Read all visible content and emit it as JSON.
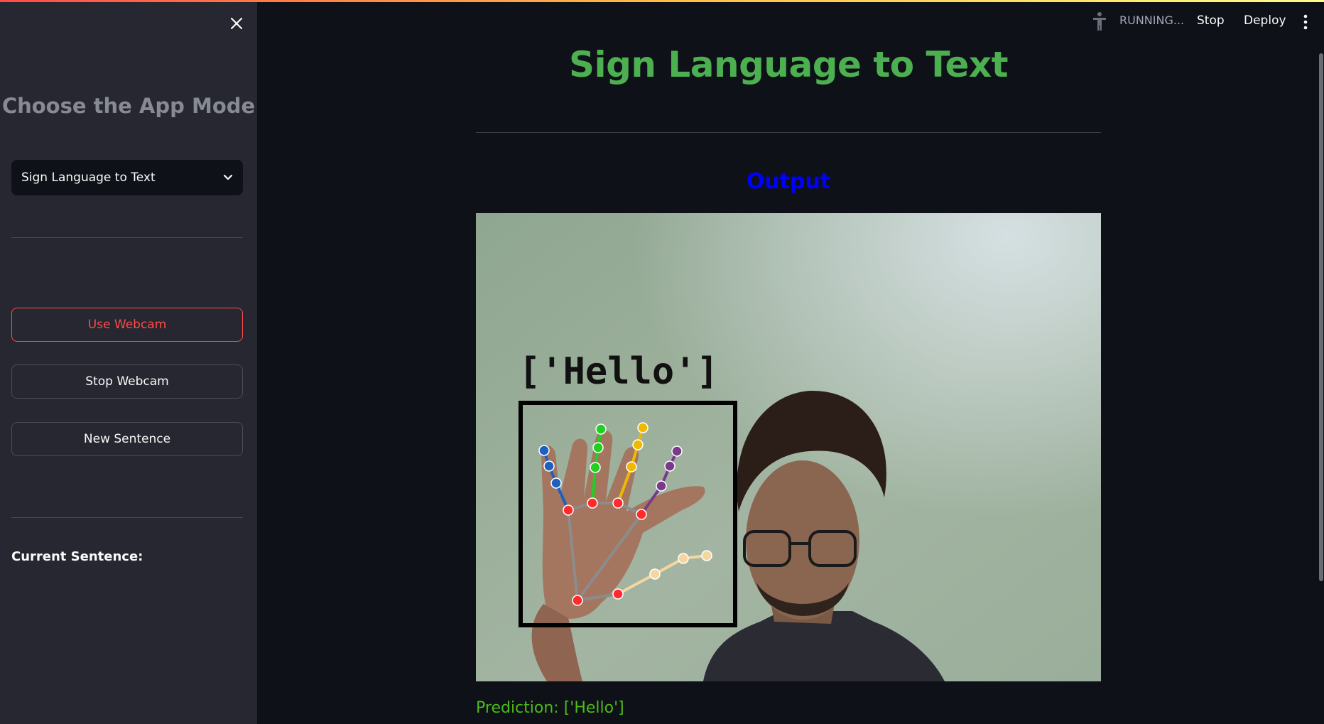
{
  "header": {
    "status": "RUNNING...",
    "stop_label": "Stop",
    "deploy_label": "Deploy"
  },
  "sidebar": {
    "title": "Choose the App Mode",
    "mode_select": {
      "value": "Sign Language to Text"
    },
    "buttons": {
      "use_webcam": "Use Webcam",
      "stop_webcam": "Stop Webcam",
      "new_sentence": "New Sentence"
    },
    "current_sentence_label": "Current Sentence:"
  },
  "main": {
    "title": "Sign Language to Text",
    "output_heading": "Output",
    "frame_overlay_text": "['Hello']",
    "prediction": "Prediction: ['Hello']"
  },
  "colors": {
    "accent_red": "#ff4b4b",
    "title_green": "#4caf50",
    "output_blue": "#0000ff",
    "prediction_green": "#4cbb17",
    "sidebar_bg": "#262730",
    "app_bg": "#0e1117"
  }
}
